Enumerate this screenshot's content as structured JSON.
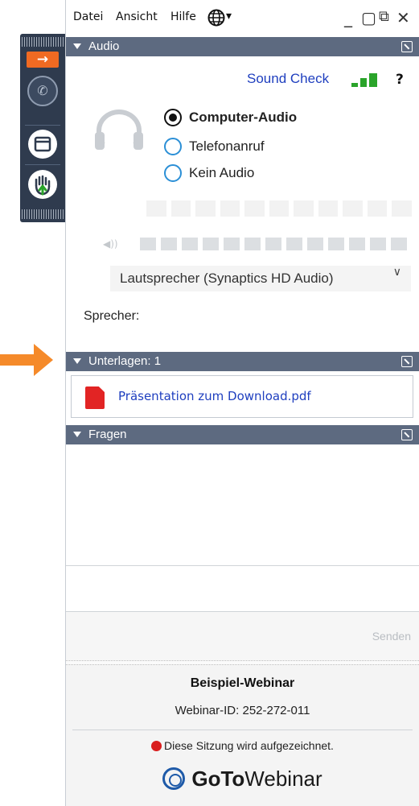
{
  "menubar": {
    "items": [
      "Datei",
      "Ansicht",
      "Hilfe"
    ],
    "globe_caret": "▾",
    "window_buttons": [
      "_",
      "▢",
      "⧉",
      "✕"
    ]
  },
  "grabtab": {
    "arrow": "→",
    "phone": "✆"
  },
  "audio": {
    "header": "Audio",
    "sound_check": "Sound Check",
    "help": "?",
    "options": [
      {
        "label": "Computer-Audio",
        "selected": true
      },
      {
        "label": "Telefonanruf",
        "selected": false
      },
      {
        "label": "Kein Audio",
        "selected": false
      }
    ],
    "vol_glyph": "◀))",
    "device": "Lautsprecher (Synaptics HD Audio)",
    "chevron": "∨",
    "speaker_label": "Sprecher:"
  },
  "documents": {
    "header": "Unterlagen: 1",
    "file": "Präsentation zum Download.pdf"
  },
  "questions": {
    "header": "Fragen",
    "send": "Senden"
  },
  "footer": {
    "title": "Beispiel-Webinar",
    "webinar_id": "Webinar-ID: 252-272-011",
    "recording": "Diese Sitzung wird aufgezeichnet.",
    "logo_bold": "GoTo",
    "logo_rest": "Webinar"
  },
  "colors": {
    "section_header": "#5d6a80",
    "accent_orange": "#f58a2a",
    "link_blue": "#1f3fbf",
    "record_red": "#d91d1d"
  }
}
